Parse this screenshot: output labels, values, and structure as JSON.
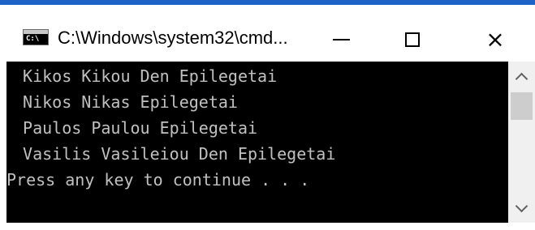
{
  "window": {
    "title": "C:\\Windows\\system32\\cmd...",
    "app_icon": "cmd-icon",
    "app_icon_text": "C:\\",
    "controls": [
      "minimize-icon",
      "maximize-icon",
      "close-icon"
    ],
    "close_glyph": "×"
  },
  "console": {
    "lines": [
      " Kikos Kikou Den Epilegetai",
      " Nikos Nikas Epilegetai",
      " Paulos Paulou Epilegetai",
      " Vasilis Vasileiou Den Epilegetai",
      "Press any key to continue . . ."
    ]
  },
  "colors": {
    "console_bg": "#000000",
    "console_text": "#c0c0c0",
    "accent": "#1d63c6"
  }
}
